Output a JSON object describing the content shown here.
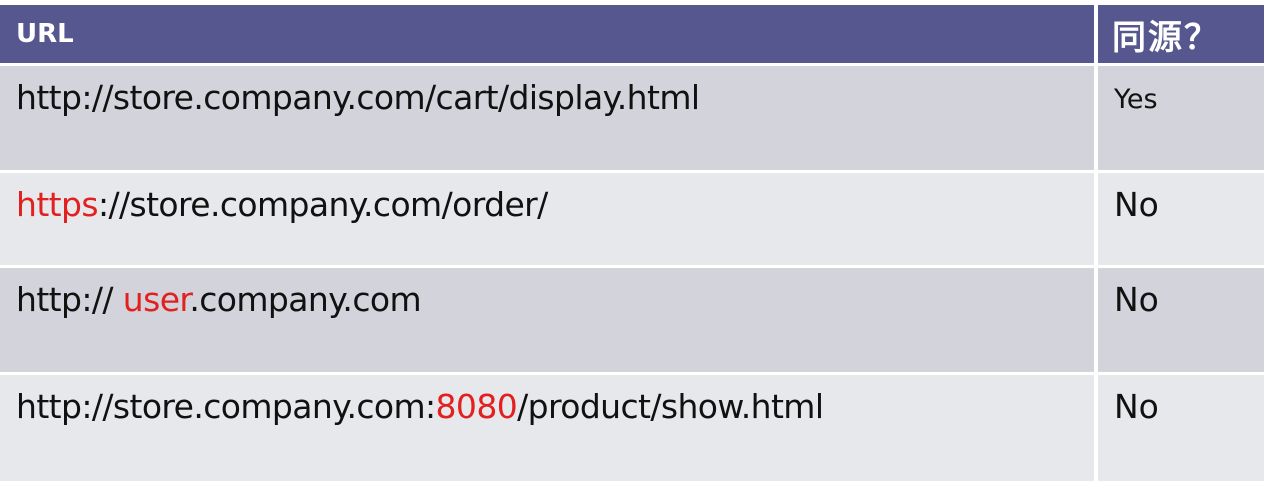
{
  "table": {
    "headers": {
      "url": "URL",
      "same_origin": "同源？"
    },
    "rows": [
      {
        "parts": [
          "http://store.company.com/cart/display.html"
        ],
        "highlight": "",
        "answer": "Yes"
      },
      {
        "parts": [
          "",
          "https",
          "://store.company.com/order/"
        ],
        "highlight": "https",
        "answer": "No"
      },
      {
        "parts": [
          "http:// ",
          "user",
          ".company.com"
        ],
        "highlight": "user",
        "answer": "No"
      },
      {
        "parts": [
          "http://store.company.com:",
          "8080",
          "/product/show.html"
        ],
        "highlight": "8080",
        "answer": "No"
      }
    ]
  },
  "colors": {
    "header_bg": "#57578f",
    "row_dark_bg": "#d2d3db",
    "row_light_bg": "#e7e8ec",
    "highlight_text": "#e32020"
  }
}
